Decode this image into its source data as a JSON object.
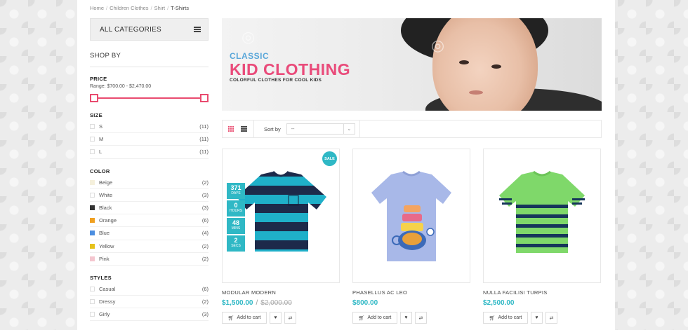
{
  "breadcrumb": [
    "Home",
    "Children Clothes",
    "Shirt",
    "T-Shirts"
  ],
  "sidebar": {
    "all_categories": "ALL CATEGORIES",
    "shop_by": "SHOP BY",
    "price": {
      "heading": "PRICE",
      "range_text": "Range: $700.00 - $2,470.00",
      "min_value": 700,
      "max_value": 2470
    },
    "size": {
      "heading": "SIZE",
      "items": [
        {
          "label": "S",
          "count": "(11)"
        },
        {
          "label": "M",
          "count": "(11)"
        },
        {
          "label": "L",
          "count": "(11)"
        }
      ]
    },
    "color": {
      "heading": "COLOR",
      "items": [
        {
          "label": "Beige",
          "count": "(2)",
          "swatch": "#f5f0dc"
        },
        {
          "label": "White",
          "count": "(3)",
          "swatch": "#ffffff"
        },
        {
          "label": "Black",
          "count": "(3)",
          "swatch": "#333333"
        },
        {
          "label": "Orange",
          "count": "(6)",
          "swatch": "#f0a020"
        },
        {
          "label": "Blue",
          "count": "(4)",
          "swatch": "#4c8ee0"
        },
        {
          "label": "Yellow",
          "count": "(2)",
          "swatch": "#e6c21b"
        },
        {
          "label": "Pink",
          "count": "(2)",
          "swatch": "#f4c6cf"
        }
      ]
    },
    "styles": {
      "heading": "STYLES",
      "items": [
        {
          "label": "Casual",
          "count": "(6)"
        },
        {
          "label": "Dressy",
          "count": "(2)"
        },
        {
          "label": "Girly",
          "count": "(3)"
        }
      ]
    }
  },
  "banner": {
    "line1": "CLASSIC",
    "line2": "KID CLOTHING",
    "line3": "COLORFUL CLOTHES FOR COOL KIDS"
  },
  "toolbar": {
    "sort_by": "Sort by",
    "sort_value": "--",
    "grid_icon": "grid-view-icon",
    "list_icon": "list-view-icon"
  },
  "products": [
    {
      "name": "MODULAR MODERN",
      "price": "$1,500.00",
      "old_price": "$2,000.00",
      "sale_badge": "SALE",
      "countdown": [
        {
          "n": "371",
          "u": "DAYS"
        },
        {
          "n": "0",
          "u": "HOURS"
        },
        {
          "n": "48",
          "u": "MINS"
        },
        {
          "n": "2",
          "u": "SECS"
        }
      ],
      "add_to_cart": "Add to cart"
    },
    {
      "name": "PHASELLUS AC LEO",
      "price": "$800.00",
      "add_to_cart": "Add to cart"
    },
    {
      "name": "NULLA FACILISI TURPIS",
      "price": "$2,500.00",
      "add_to_cart": "Add to cart"
    }
  ],
  "colors": {
    "accent_pink": "#e94b6f",
    "accent_teal": "#2fb8c5"
  }
}
